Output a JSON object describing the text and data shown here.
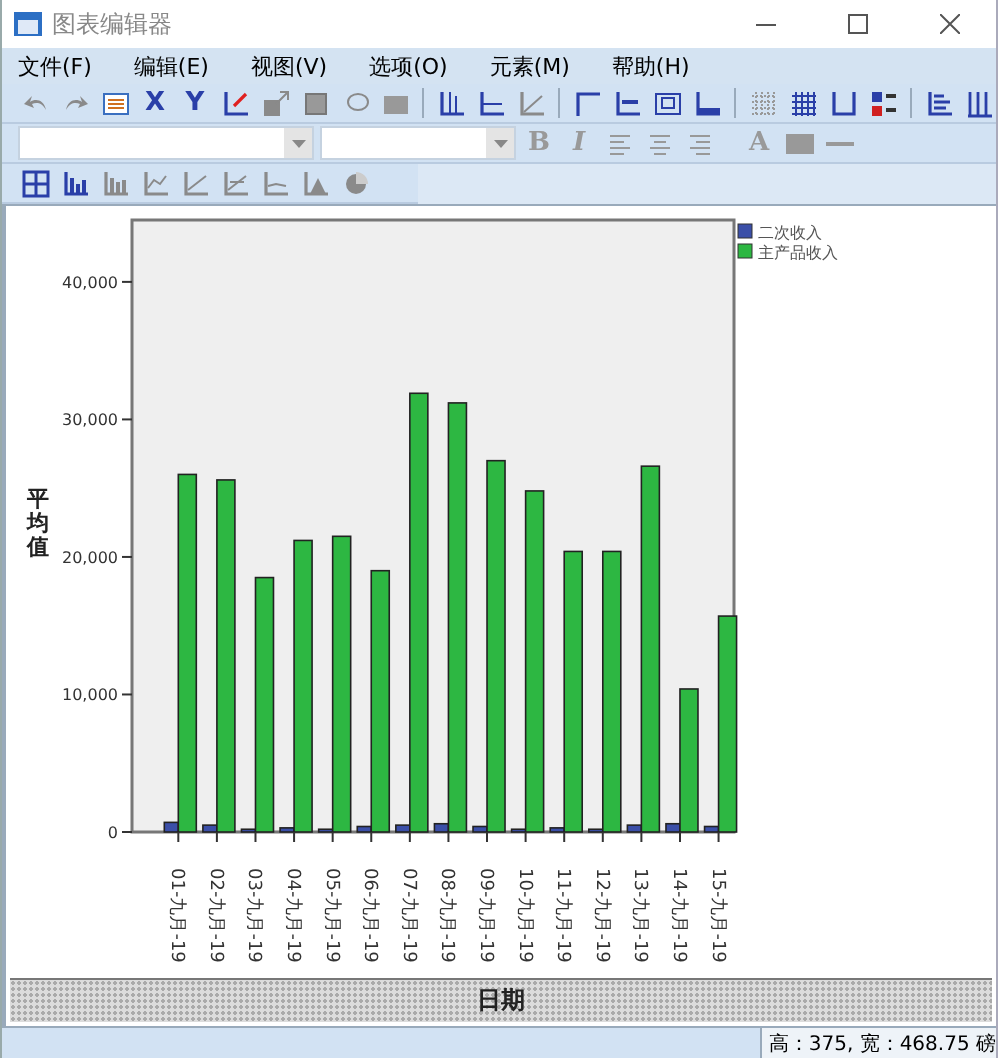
{
  "window": {
    "title": "图表编辑器"
  },
  "menu": [
    "文件(F)",
    "编辑(E)",
    "视图(V)",
    "选项(O)",
    "元素(M)",
    "帮助(H)"
  ],
  "toolbar_letters": {
    "axis_x": "X",
    "axis_y": "Y",
    "bold": "B",
    "italic": "I",
    "text_color": "A"
  },
  "chart_data": {
    "type": "bar",
    "ylabel": "平均值",
    "xlabel": "日期",
    "categories": [
      "01-九月-19",
      "02-九月-19",
      "03-九月-19",
      "04-九月-19",
      "05-九月-19",
      "06-九月-19",
      "07-九月-19",
      "08-九月-19",
      "09-九月-19",
      "10-九月-19",
      "11-九月-19",
      "12-九月-19",
      "13-九月-19",
      "14-九月-19",
      "15-九月-19"
    ],
    "series": [
      {
        "name": "二次收入",
        "color": "#3b4fa8",
        "values": [
          700,
          500,
          200,
          300,
          200,
          400,
          500,
          600,
          400,
          200,
          300,
          200,
          500,
          600,
          400
        ]
      },
      {
        "name": "主产品收入",
        "color": "#2db742",
        "values": [
          26000,
          25600,
          18500,
          21200,
          21500,
          19000,
          31900,
          31200,
          27000,
          24800,
          20400,
          20400,
          26600,
          10400,
          15700
        ]
      }
    ],
    "ylim": [
      0,
      44500
    ],
    "legend": "right",
    "yticks": [
      {
        "value": 0,
        "label": "0"
      },
      {
        "value": 10000,
        "label": "10,000"
      },
      {
        "value": 20000,
        "label": "20,000"
      },
      {
        "value": 30000,
        "label": "30,000"
      },
      {
        "value": 40000,
        "label": "40,000"
      }
    ]
  },
  "status_bar": {
    "size": "高：375, 宽：468.75 磅"
  }
}
